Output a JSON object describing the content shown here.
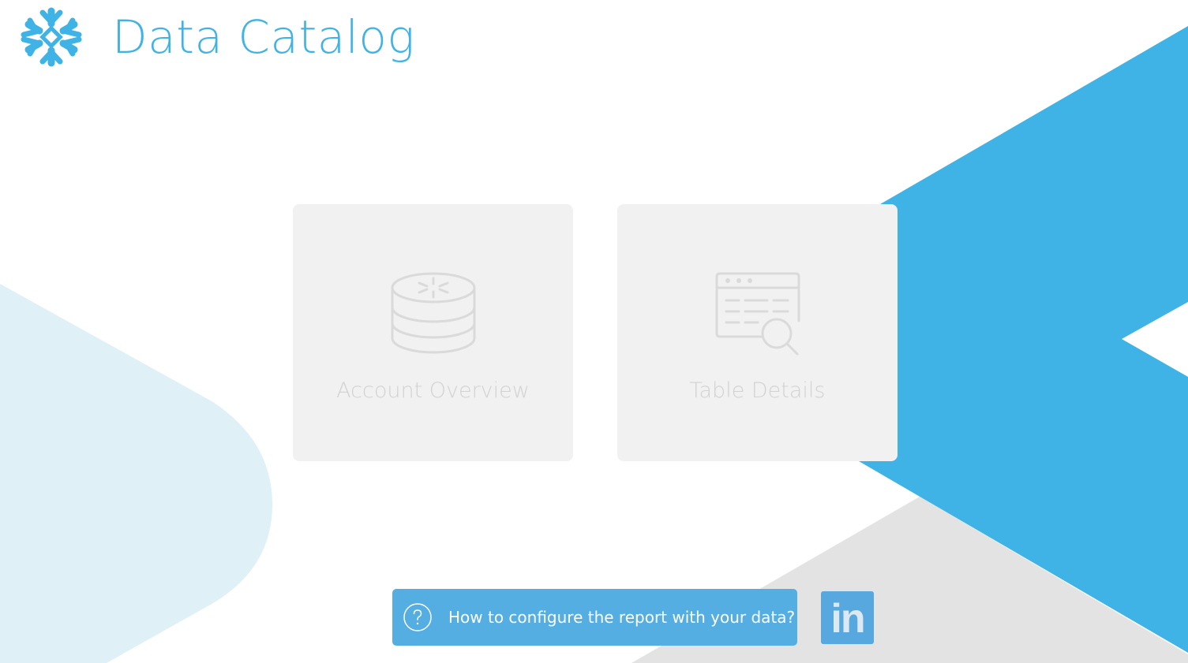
{
  "app": {
    "title": "Data Catalog",
    "logo_icon": "snowflake-icon",
    "accent_color": "#3fb3e6"
  },
  "tiles": [
    {
      "label": "Account Overview",
      "icon": "database-snowflake-icon"
    },
    {
      "label": "Table Details",
      "icon": "table-search-icon"
    }
  ],
  "help": {
    "label": "How to configure the report with your data?",
    "icon": "question-circle-icon"
  },
  "social": {
    "label": "in",
    "icon": "linkedin-icon"
  },
  "colors": {
    "brand_blue": "#3fb3e6",
    "light_blue": "#dff0f7",
    "light_gray": "#e3e3e3",
    "tile_bg": "#f1f1f1",
    "tile_text": "#d2d2d2"
  }
}
